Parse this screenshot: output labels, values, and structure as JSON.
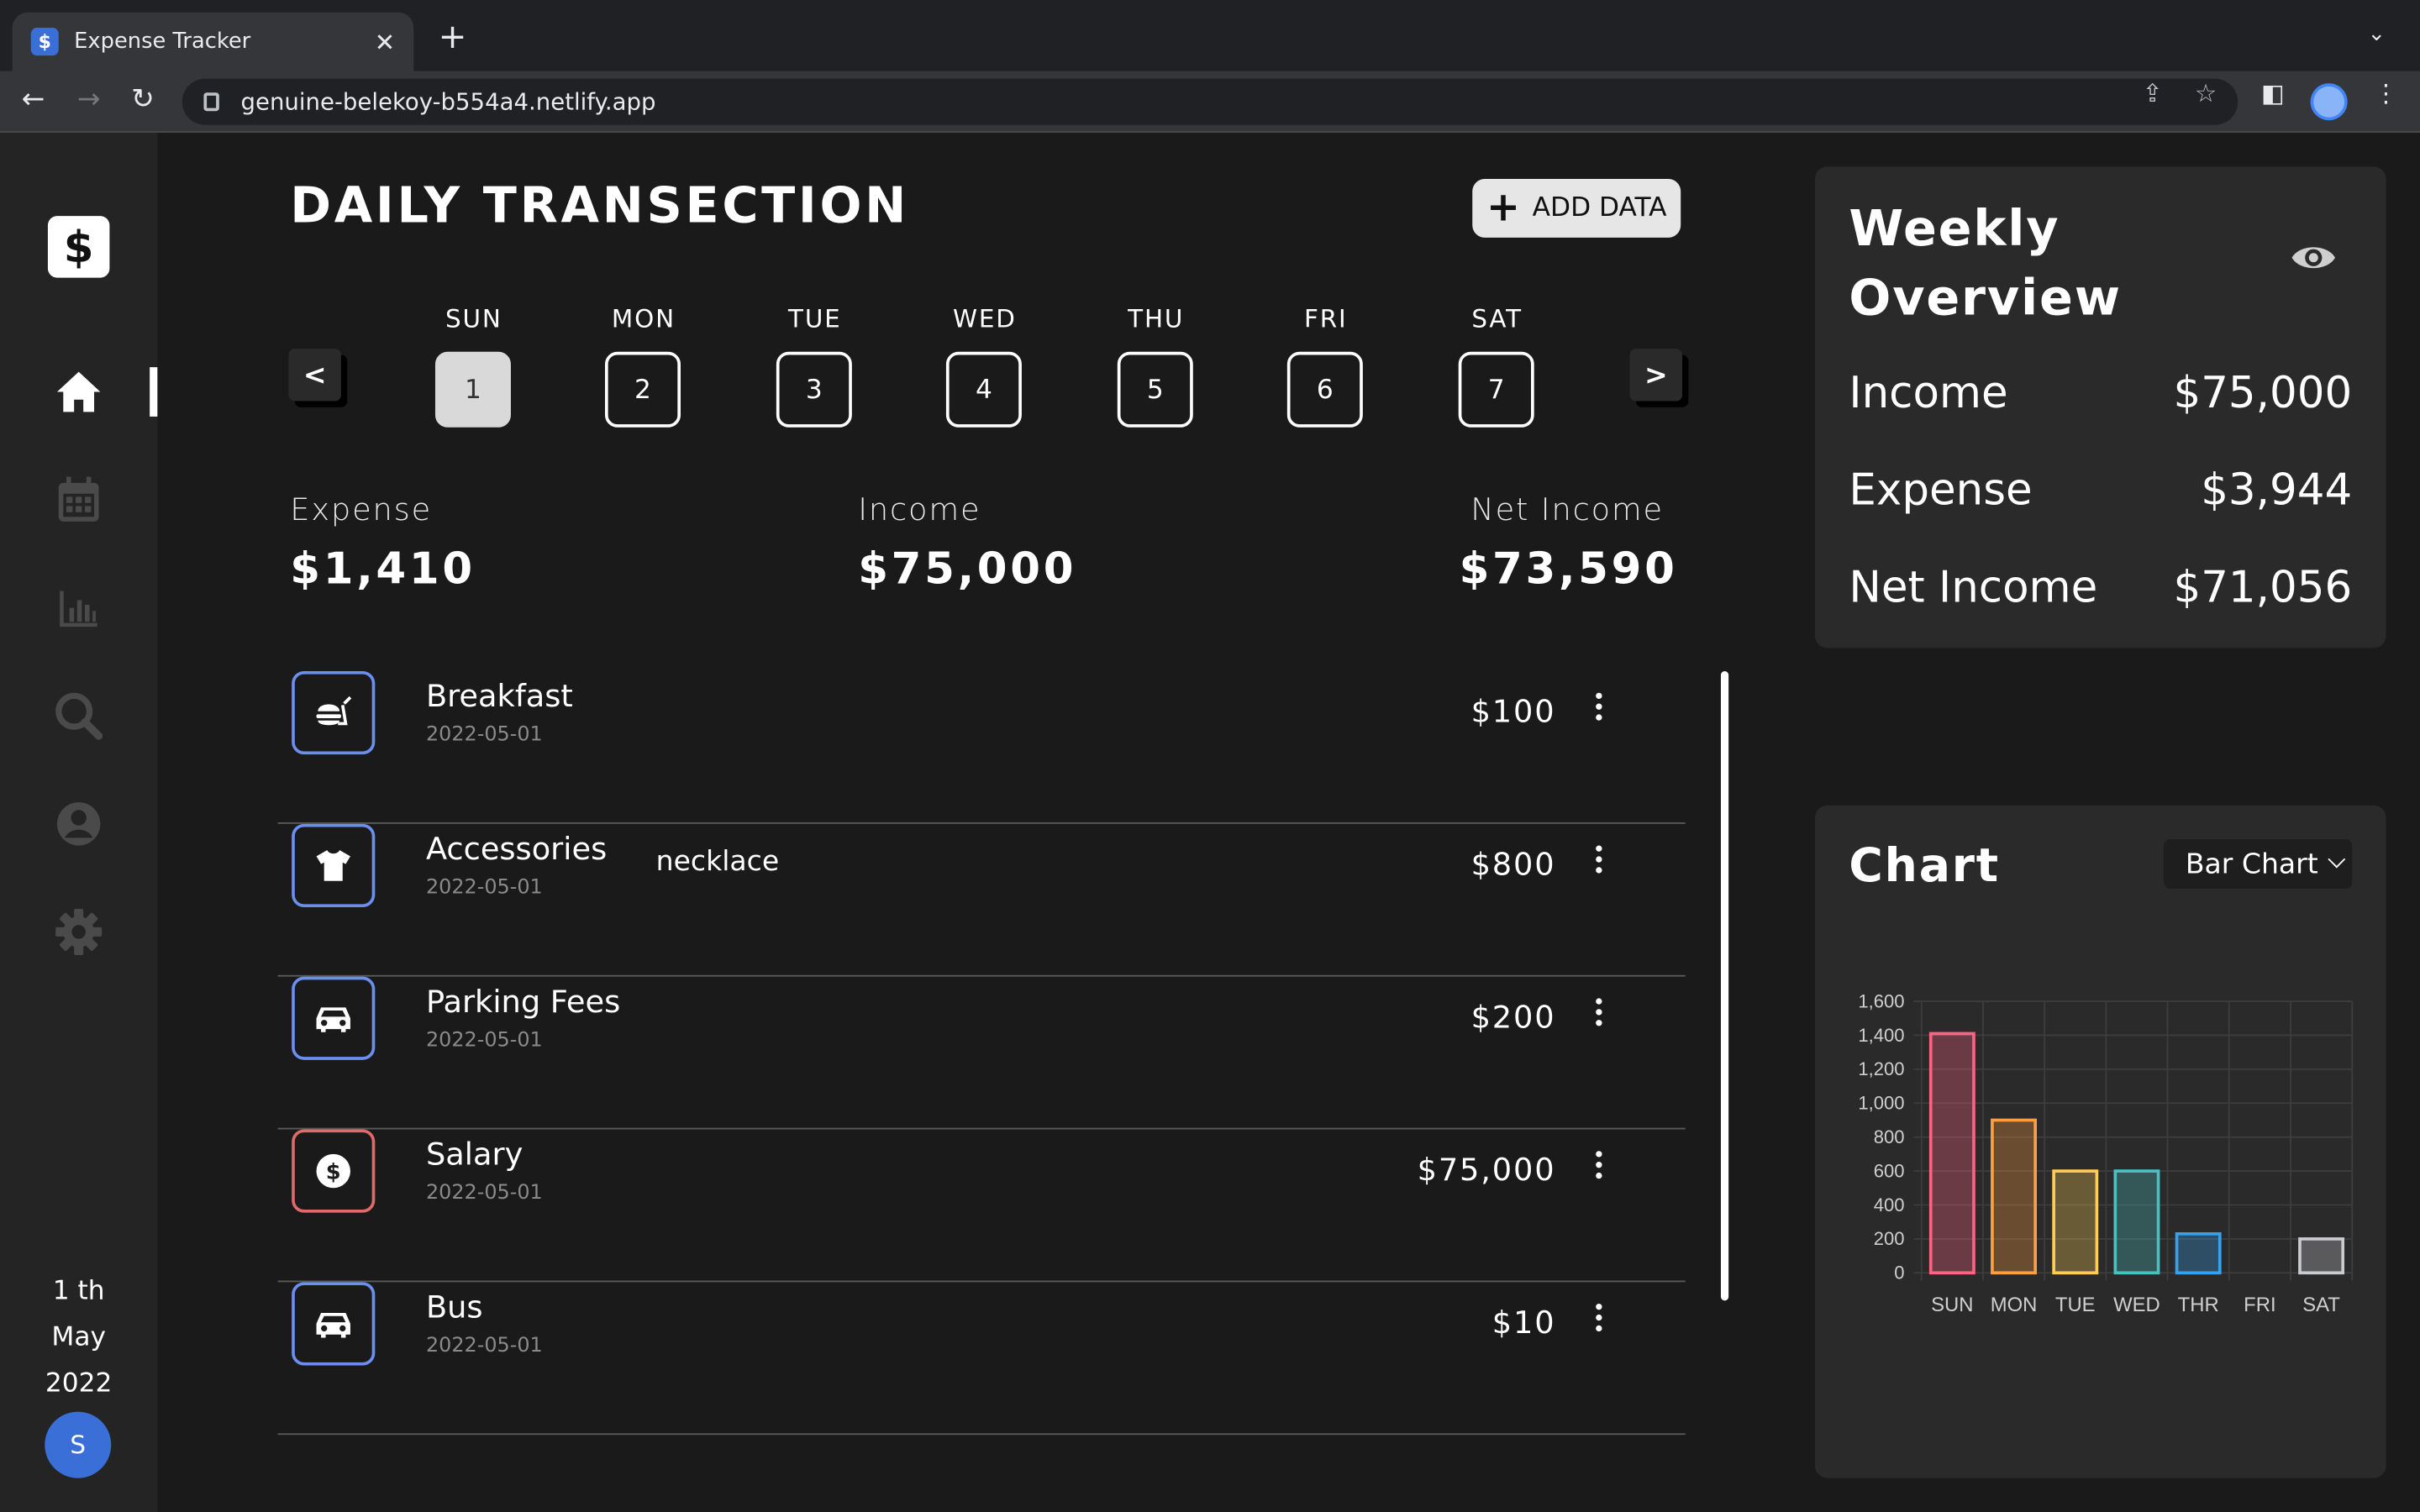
{
  "browser": {
    "tab_title": "Expense Tracker",
    "favicon": "$",
    "url": "genuine-belekoy-b554a4.netlify.app"
  },
  "sidebar": {
    "logo": "$",
    "items": [
      {
        "icon": "home-icon",
        "active": true
      },
      {
        "icon": "calendar-icon",
        "active": false
      },
      {
        "icon": "bar-chart-icon",
        "active": false
      },
      {
        "icon": "search-icon",
        "active": false
      },
      {
        "icon": "user-icon",
        "active": false
      },
      {
        "icon": "settings-icon",
        "active": false
      }
    ],
    "date": {
      "day": "1 th",
      "month": "May",
      "year": "2022"
    },
    "avatar_initial": "S"
  },
  "main": {
    "title": "DAILY TRANSECTION",
    "add_button": "ADD DATA",
    "prev": "<",
    "next": ">",
    "days": [
      {
        "name": "SUN",
        "num": "1",
        "selected": true
      },
      {
        "name": "MON",
        "num": "2",
        "selected": false
      },
      {
        "name": "TUE",
        "num": "3",
        "selected": false
      },
      {
        "name": "WED",
        "num": "4",
        "selected": false
      },
      {
        "name": "THU",
        "num": "5",
        "selected": false
      },
      {
        "name": "FRI",
        "num": "6",
        "selected": false
      },
      {
        "name": "SAT",
        "num": "7",
        "selected": false
      }
    ],
    "summary": {
      "expense_label": "Expense",
      "expense": "$1,410",
      "income_label": "Income",
      "income": "$75,000",
      "net_label": "Net Income",
      "net": "$73,590"
    },
    "transactions": [
      {
        "name": "Breakfast",
        "date": "2022-05-01",
        "note": "",
        "amount": "$100",
        "icon": "burger-icon",
        "type": "expense"
      },
      {
        "name": "Accessories",
        "date": "2022-05-01",
        "note": "necklace",
        "amount": "$800",
        "icon": "shirt-icon",
        "type": "expense"
      },
      {
        "name": "Parking Fees",
        "date": "2022-05-01",
        "note": "",
        "amount": "$200",
        "icon": "car-icon",
        "type": "expense"
      },
      {
        "name": "Salary",
        "date": "2022-05-01",
        "note": "",
        "amount": "$75,000",
        "icon": "dollar-coin-icon",
        "type": "income"
      },
      {
        "name": "Bus",
        "date": "2022-05-01",
        "note": "",
        "amount": "$10",
        "icon": "car-icon",
        "type": "expense"
      }
    ]
  },
  "overview": {
    "title_line1": "Weekly",
    "title_line2": "Overview",
    "income_label": "Income",
    "income": "$75,000",
    "expense_label": "Expense",
    "expense": "$3,944",
    "net_label": "Net Income",
    "net": "$71,056"
  },
  "chart_panel": {
    "title": "Chart",
    "select_value": "Bar Chart"
  },
  "chart_data": {
    "type": "bar",
    "categories": [
      "SUN",
      "MON",
      "TUE",
      "WED",
      "THR",
      "FRI",
      "SAT"
    ],
    "values": [
      1410,
      900,
      600,
      600,
      230,
      0,
      200
    ],
    "ylim": [
      0,
      1600
    ],
    "yticks": [
      "0",
      "200",
      "400",
      "600",
      "800",
      "1,000",
      "1,200",
      "1,400",
      "1,600"
    ],
    "colors": [
      "#ff6384",
      "#ff9f40",
      "#ffcd56",
      "#4bc0c0",
      "#36a2eb",
      "#9966ff",
      "#c9cbcf"
    ],
    "grid": true,
    "legend": "none"
  }
}
